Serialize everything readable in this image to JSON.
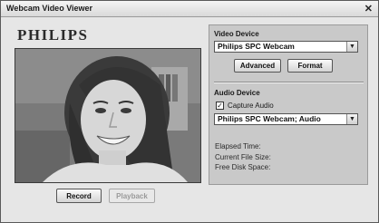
{
  "window": {
    "title": "Webcam Video Viewer",
    "close_glyph": "✕"
  },
  "brand": {
    "logo": "PHILIPS"
  },
  "controls": {
    "record_label": "Record",
    "playback_label": "Playback"
  },
  "video_device": {
    "heading": "Video Device",
    "selected": "Philips SPC Webcam",
    "advanced_label": "Advanced",
    "format_label": "Format"
  },
  "audio_device": {
    "heading": "Audio Device",
    "capture_label": "Capture Audio",
    "capture_checked": true,
    "check_glyph": "✓",
    "selected": "Philips SPC Webcam; Audio"
  },
  "status": {
    "elapsed_label": "Elapsed Time:",
    "file_size_label": "Current File Size:",
    "disk_space_label": "Free Disk Space:"
  },
  "icons": {
    "dropdown": "chevron-down-icon"
  }
}
